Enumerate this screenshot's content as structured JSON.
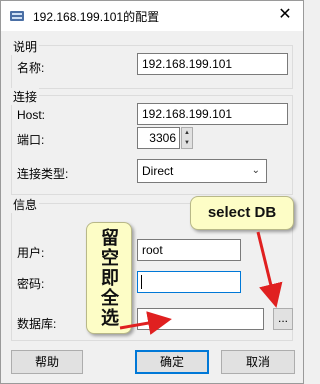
{
  "window": {
    "title": "192.168.199.101的配置",
    "close_glyph": "✕"
  },
  "groups": {
    "description": {
      "label": "说明",
      "name_label": "名称:",
      "name_value": "192.168.199.101"
    },
    "connection": {
      "label": "连接",
      "host_label": "Host:",
      "host_value": "192.168.199.101",
      "port_label": "端口:",
      "port_value": "3306",
      "type_label": "连接类型:",
      "type_value": "Direct"
    },
    "info": {
      "label": "信息",
      "user_label": "用户:",
      "user_value": "root",
      "password_label": "密码:",
      "password_value": "",
      "database_label": "数据库:",
      "database_value": "",
      "browse_label": "..."
    }
  },
  "buttons": {
    "help": "帮助",
    "ok": "确定",
    "cancel": "取消"
  },
  "annotations": {
    "leave_empty_lines": [
      "留",
      "空",
      "即",
      "全",
      "选"
    ],
    "select_db": "select DB",
    "arrow_color": "#e02020",
    "callout_color": "#fdfdc6"
  },
  "icons": {
    "app": "database-icon",
    "close": "close-icon",
    "spin_up": "chevron-up-icon",
    "spin_down": "chevron-down-icon",
    "dropdown": "chevron-down-icon"
  }
}
